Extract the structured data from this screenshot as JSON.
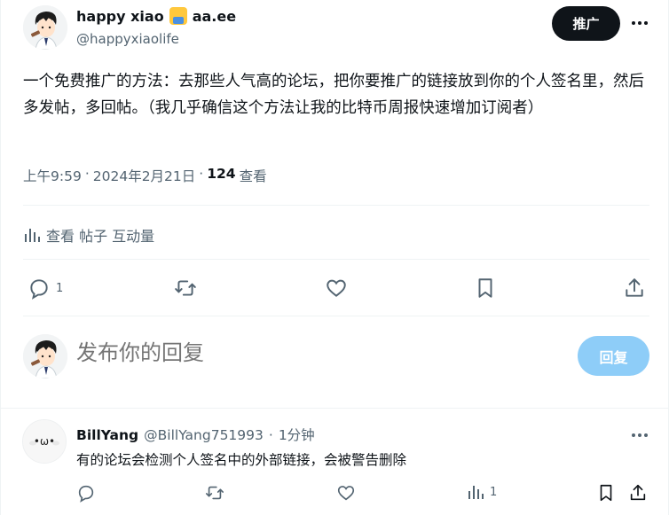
{
  "post": {
    "author_name": "happy xiao",
    "author_suffix": "aa.ee",
    "author_handle": "@happyxiaolife",
    "promote_label": "推广",
    "text": "一个免费推广的方法：去那些人气高的论坛，把你要推广的链接放到你的个人签名里，然后多发帖，多回帖。（我几乎确信这个方法让我的比特币周报快速增加订阅者）",
    "time": "上午9:59",
    "date": "2024年2月21日",
    "views_count": "124",
    "views_label": "查看",
    "analytics_label": "查看 帖子 互动量",
    "reply_count": "1"
  },
  "reply_box": {
    "placeholder": "发布你的回复",
    "button_label": "回复"
  },
  "comment": {
    "name": "BillYang",
    "handle": "@BillYang751993",
    "time": "1分钟",
    "text": "有的论坛会检测个人签名中的外部链接，会被警告删除",
    "views_count": "1",
    "avatar_face": "•ω•"
  },
  "icons": {
    "more": "more-dots-icon",
    "reply": "reply-bubble-icon",
    "repost": "repost-icon",
    "like": "heart-icon",
    "bookmark": "bookmark-icon",
    "share": "share-icon",
    "analytics": "bar-chart-icon"
  },
  "colors": {
    "text": "#0f1419",
    "muted": "#536471",
    "reply_button": "#8ecdf8",
    "promote_button": "#0f1419"
  }
}
